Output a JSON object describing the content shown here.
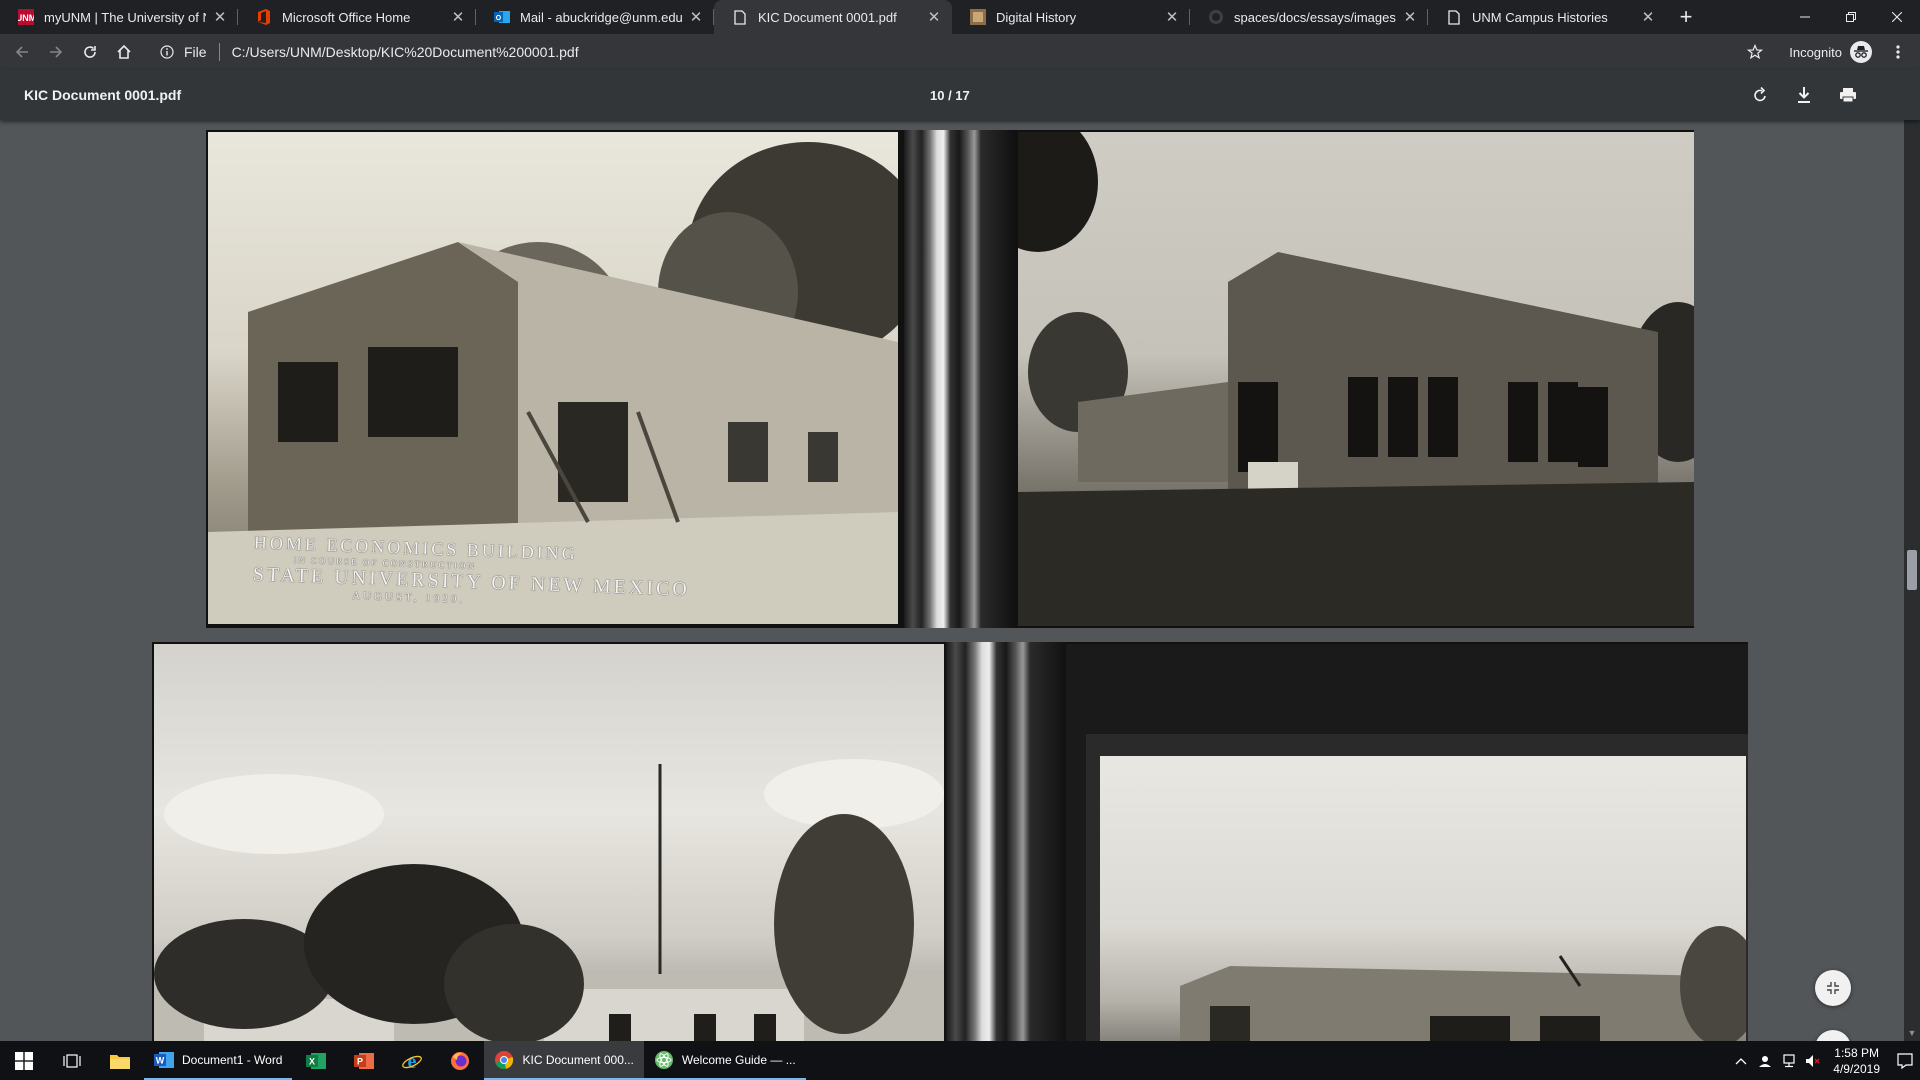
{
  "browser": {
    "tabs": [
      {
        "title": "myUNM | The University of New",
        "icon": "unm-icon",
        "active": false
      },
      {
        "title": "Microsoft Office Home",
        "icon": "office-icon",
        "active": false
      },
      {
        "title": "Mail - abuckridge@unm.edu",
        "icon": "outlook-icon",
        "active": false
      },
      {
        "title": "KIC Document 0001.pdf",
        "icon": "document-icon",
        "active": true
      },
      {
        "title": "Digital History",
        "icon": "digital-history-icon",
        "active": false
      },
      {
        "title": "spaces/docs/essays/images at m",
        "icon": "github-icon",
        "active": false
      },
      {
        "title": "UNM Campus Histories",
        "icon": "document-icon",
        "active": false
      }
    ],
    "new_tab_label": "+",
    "address": {
      "scheme_label": "File",
      "url": "C:/Users/UNM/Desktop/KIC%20Document%200001.pdf"
    },
    "profile_label": "Incognito"
  },
  "pdf": {
    "title": "KIC Document 0001.pdf",
    "page_indicator": "10 / 17",
    "caption": {
      "line1": "HOME ECONOMICS BUILDING",
      "line2": "IN COURSE OF CONSTRUCTION",
      "line3": "STATE UNIVERSITY OF NEW MEXICO",
      "line4": "AUGUST, 1920."
    }
  },
  "taskbar": {
    "apps": [
      {
        "label": "Document1 - Word",
        "icon": "word-icon"
      },
      {
        "label": "KIC Document 000...",
        "icon": "chrome-icon",
        "active": true
      },
      {
        "label": "Welcome Guide — ...",
        "icon": "atom-icon"
      }
    ],
    "clock": {
      "time": "1:58 PM",
      "date": "4/9/2019"
    }
  },
  "colors": {
    "tabstrip_bg": "#202124",
    "toolbar_bg": "#35363a",
    "pdf_toolbar_bg": "#323639",
    "viewer_bg": "#525659",
    "taskbar_bg": "#101114",
    "taskbar_accent": "#76b9ed"
  }
}
